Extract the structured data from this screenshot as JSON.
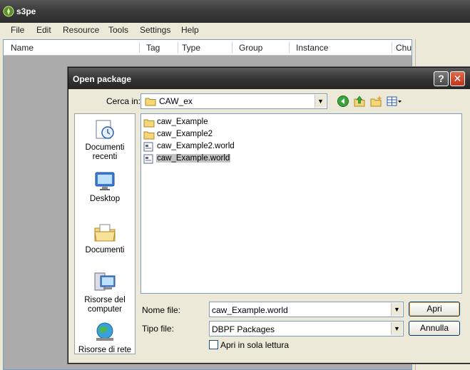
{
  "app": {
    "title": "s3pe"
  },
  "menu": [
    "File",
    "Edit",
    "Resource",
    "Tools",
    "Settings",
    "Help"
  ],
  "grid": {
    "columns": [
      "Name",
      "Tag",
      "Type",
      "Group",
      "Instance",
      "Chu"
    ]
  },
  "dialog": {
    "title": "Open package",
    "help_glyph": "?",
    "close_glyph": "✕",
    "lookin_label": "Cerca in:",
    "lookin_value": "CAW_ex",
    "places": [
      "Documenti recenti",
      "Desktop",
      "Documenti",
      "Risorse del computer",
      "Risorse di rete"
    ],
    "files": [
      {
        "name": "caw_Example",
        "kind": "folder"
      },
      {
        "name": "caw_Example2",
        "kind": "folder"
      },
      {
        "name": "caw_Example2.world",
        "kind": "file"
      },
      {
        "name": "caw_Example.world",
        "kind": "file",
        "selected": true
      }
    ],
    "filename_label": "Nome file:",
    "filename_value": "caw_Example.world",
    "filetype_label": "Tipo file:",
    "filetype_value": "DBPF Packages",
    "open_label": "Apri",
    "cancel_label": "Annulla",
    "readonly_label": "Apri in sola lettura",
    "readonly_checked": false
  }
}
